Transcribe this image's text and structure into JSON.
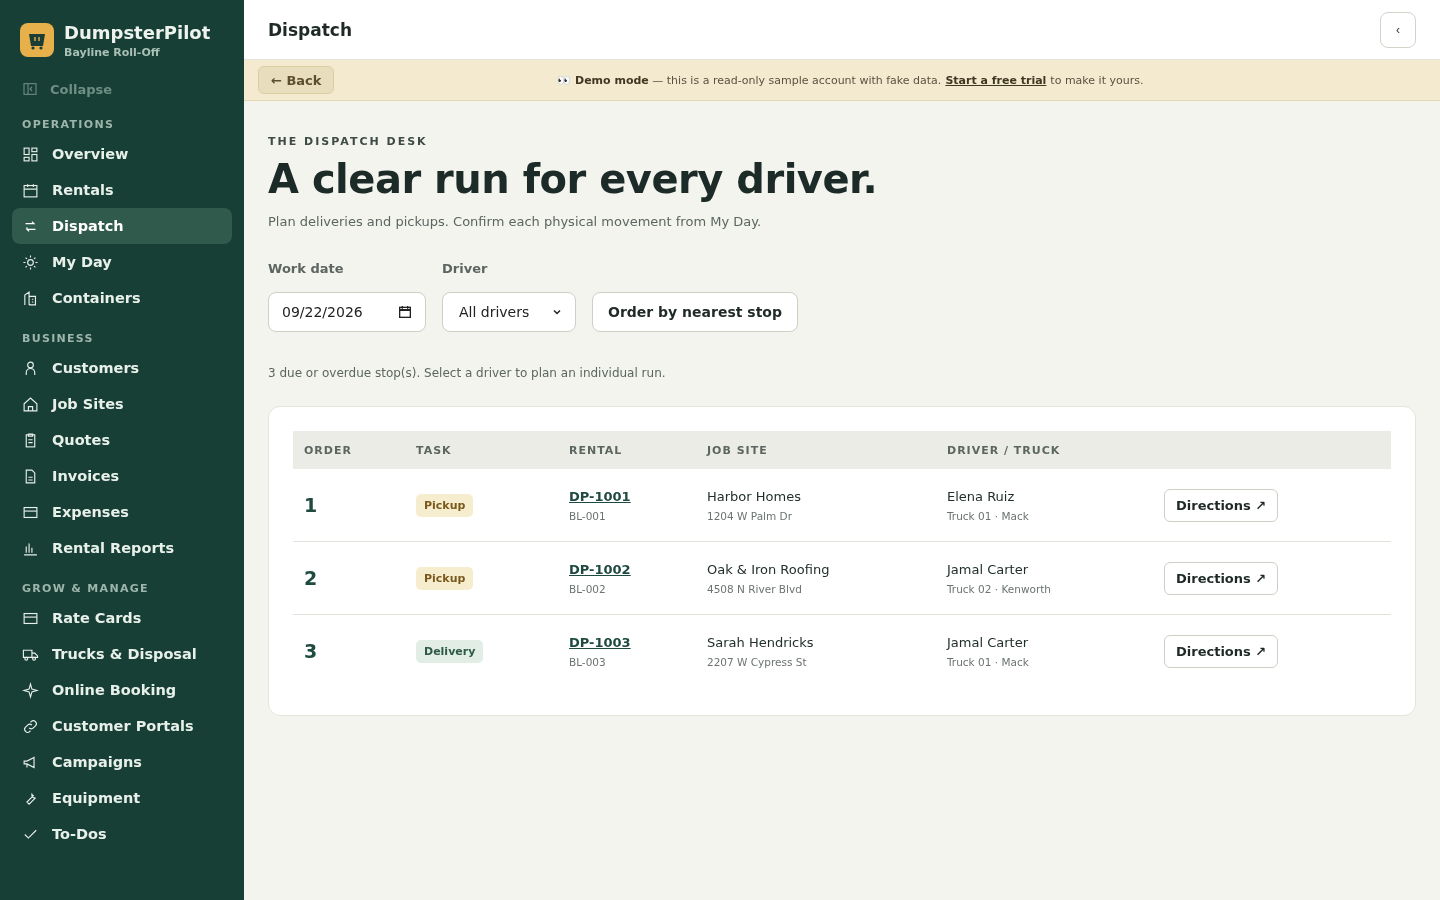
{
  "brand": {
    "name": "DumpsterPilot",
    "subtitle": "Bayline Roll-Off"
  },
  "collapse": "Collapse",
  "sidebar": [
    {
      "heading": "OPERATIONS",
      "items": [
        {
          "label": "Overview",
          "selected": false
        },
        {
          "label": "Rentals",
          "selected": false
        },
        {
          "label": "Dispatch",
          "selected": true
        },
        {
          "label": "My Day",
          "selected": false
        },
        {
          "label": "Containers",
          "selected": false
        }
      ]
    },
    {
      "heading": "BUSINESS",
      "items": [
        {
          "label": "Customers",
          "selected": false
        },
        {
          "label": "Job Sites",
          "selected": false
        },
        {
          "label": "Quotes",
          "selected": false
        },
        {
          "label": "Invoices",
          "selected": false
        },
        {
          "label": "Expenses",
          "selected": false
        },
        {
          "label": "Rental Reports",
          "selected": false
        }
      ]
    },
    {
      "heading": "GROW & MANAGE",
      "items": [
        {
          "label": "Rate Cards",
          "selected": false
        },
        {
          "label": "Trucks & Disposal",
          "selected": false
        },
        {
          "label": "Online Booking",
          "selected": false
        },
        {
          "label": "Customer Portals",
          "selected": false
        },
        {
          "label": "Campaigns",
          "selected": false
        },
        {
          "label": "Equipment",
          "selected": false
        },
        {
          "label": "To-Dos",
          "selected": false
        }
      ]
    }
  ],
  "header": {
    "title": "Dispatch",
    "toggle": "‹"
  },
  "banner": {
    "back": "← Back",
    "icon": "👀",
    "text": "**Demo mode** — this is a read-only sample account with fake data.",
    "link": "Start a free trial",
    "after": "to make it yours."
  },
  "eyebrow": "THE DISPATCH DESK",
  "headline": "A clear run for every driver.",
  "intro": "Plan deliveries and pickups. Confirm each physical movement from My Day.",
  "filters": {
    "date_label": "Work date",
    "date_value": "09/22/2026",
    "driver_label": "Driver",
    "driver_value": "All drivers",
    "order_button": "Order by nearest stop"
  },
  "summary": "3 due or overdue stop(s). Select a driver to plan an individual run.",
  "table": {
    "columns": [
      "ORDER",
      "TASK",
      "RENTAL",
      "JOB SITE",
      "DRIVER / TRUCK"
    ],
    "rows": [
      {
        "order": "1",
        "task": "Pickup",
        "kind": "pickup",
        "rental": "DP-1001",
        "rental_sub": "BL-001",
        "site": "Harbor Homes",
        "address": "1204 W Palm Dr",
        "driver": "Elena Ruiz",
        "truck": "Truck 01 · Mack",
        "action": "Directions ↗"
      },
      {
        "order": "2",
        "task": "Pickup",
        "kind": "pickup",
        "rental": "DP-1002",
        "rental_sub": "BL-002",
        "site": "Oak & Iron Roofing",
        "address": "4508 N River Blvd",
        "driver": "Jamal Carter",
        "truck": "Truck 02 · Kenworth",
        "action": "Directions ↗"
      },
      {
        "order": "3",
        "task": "Delivery",
        "kind": "delivery",
        "rental": "DP-1003",
        "rental_sub": "BL-003",
        "site": "Sarah Hendricks",
        "address": "2207 W Cypress St",
        "driver": "Jamal Carter",
        "truck": "Truck 01 · Mack",
        "action": "Directions ↗"
      }
    ]
  }
}
